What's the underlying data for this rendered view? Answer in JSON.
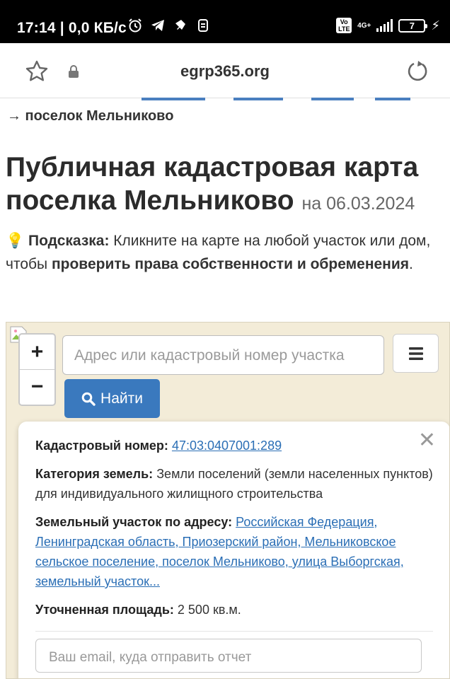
{
  "statusbar": {
    "time": "17:14 | 0,0 КБ/с",
    "volte": "Vo LTE",
    "network": "4G+",
    "battery": "7"
  },
  "browser": {
    "url": "egrp365.org"
  },
  "breadcrumb": "→ поселок Мельниково",
  "title": {
    "main": "Публичная кадастровая карта поселка Мельниково",
    "date": "на 06.03.2024"
  },
  "hint": {
    "label": "Подсказка:",
    "text1": "Кликните на карте на любой участок или дом, чтобы",
    "bold": "проверить права собственности и обременения",
    "text2": "."
  },
  "map": {
    "zoom_in": "+",
    "zoom_out": "−",
    "search_placeholder": "Адрес или кадастровый номер участка",
    "find_label": "Найти"
  },
  "popup": {
    "cad_label": "Кадастровый номер:",
    "cad_value": "47:03:0407001:289",
    "cat_label": "Категория земель:",
    "cat_value": "Земли поселений (земли населенных пунктов)",
    "use_value": "для индивидуального жилищного строительства",
    "addr_label": "Земельный участок по адресу:",
    "addr_value": "Российская Федерация, Ленинградская область, Приозерский район, Мельниковское сельское поселение, поселок Мельниково, улица Выборгская, земельный участок...",
    "area_label": "Уточненная площадь:",
    "area_value": "2 500 кв.м.",
    "email_placeholder": "Ваш email, куда отправить отчет"
  }
}
